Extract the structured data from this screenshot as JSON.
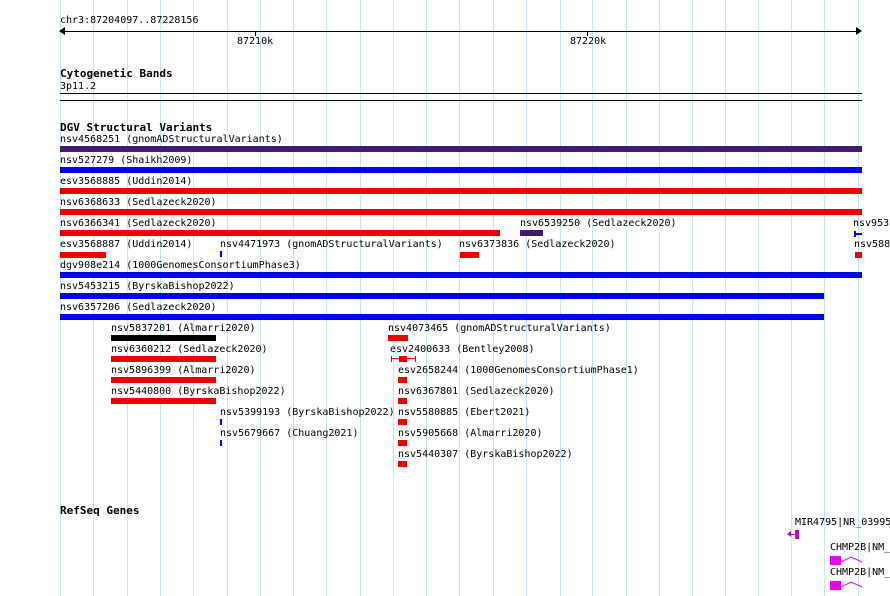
{
  "ruler": {
    "range_label": "chr3:87204097..87228156",
    "ticks": [
      {
        "label": "87210k"
      },
      {
        "label": "87220k"
      }
    ]
  },
  "cyto": {
    "title": "Cytogenetic Bands",
    "band": "3p11.2"
  },
  "dgv": {
    "title": "DGV Structural Variants",
    "colors": {
      "purple": "#3f1b73",
      "blue": "#0000ee",
      "red": "#ee0000",
      "black": "#000000"
    },
    "features": [
      {
        "label": "nsv4568251 (gnomADStructuralVariants)",
        "color": "purple"
      },
      {
        "label": "nsv527279 (Shaikh2009)",
        "color": "blue"
      },
      {
        "label": "esv3568885 (Uddin2014)",
        "color": "red"
      },
      {
        "label": "nsv6368633 (Sedlazeck2020)",
        "color": "red"
      },
      {
        "label": "nsv6366341 (Sedlazeck2020)",
        "color": "red"
      },
      {
        "label": "nsv6539250 (Sedlazeck2020)",
        "color": "purple"
      },
      {
        "label": "nsv953",
        "color": "blue"
      },
      {
        "label": "esv3568887 (Uddin2014)",
        "color": "red"
      },
      {
        "label": "nsv4471973 (gnomADStructuralVariants)",
        "color": "blue"
      },
      {
        "label": "nsv6373836 (Sedlazeck2020)",
        "color": "red"
      },
      {
        "label": "nsv588",
        "color": "red"
      },
      {
        "label": "dgv908e214 (1000GenomesConsortiumPhase3)",
        "color": "blue"
      },
      {
        "label": "nsv5453215 (ByrskaBishop2022)",
        "color": "blue"
      },
      {
        "label": "nsv6357206 (Sedlazeck2020)",
        "color": "blue"
      },
      {
        "label": "nsv5837201 (Almarri2020)",
        "color": "black"
      },
      {
        "label": "nsv4073465 (gnomADStructuralVariants)",
        "color": "red"
      },
      {
        "label": "nsv6360212 (Sedlazeck2020)",
        "color": "red"
      },
      {
        "label": "esv2400633 (Bentley2008)",
        "color": "red"
      },
      {
        "label": "nsv5896399 (Almarri2020)",
        "color": "red"
      },
      {
        "label": "esv2658244 (1000GenomesConsortiumPhase1)",
        "color": "red"
      },
      {
        "label": "nsv5440800 (ByrskaBishop2022)",
        "color": "red"
      },
      {
        "label": "nsv6367801 (Sedlazeck2020)",
        "color": "red"
      },
      {
        "label": "nsv5399193 (ByrskaBishop2022)",
        "color": "blue"
      },
      {
        "label": "nsv5580885 (Ebert2021)",
        "color": "red"
      },
      {
        "label": "nsv5679667 (Chuang2021)",
        "color": "blue"
      },
      {
        "label": "nsv5905668 (Almarri2020)",
        "color": "red"
      },
      {
        "label": "nsv5440307 (ByrskaBishop2022)",
        "color": "red"
      }
    ]
  },
  "refseq": {
    "title": "RefSeq Genes",
    "colors": {
      "mir": "#cc00cc",
      "gene": "#ee00ee"
    },
    "features": [
      {
        "label": "MIR4795|NR_03995"
      },
      {
        "label": "CHMP2B|NM_"
      },
      {
        "label": "CHMP2B|NM_"
      }
    ]
  }
}
